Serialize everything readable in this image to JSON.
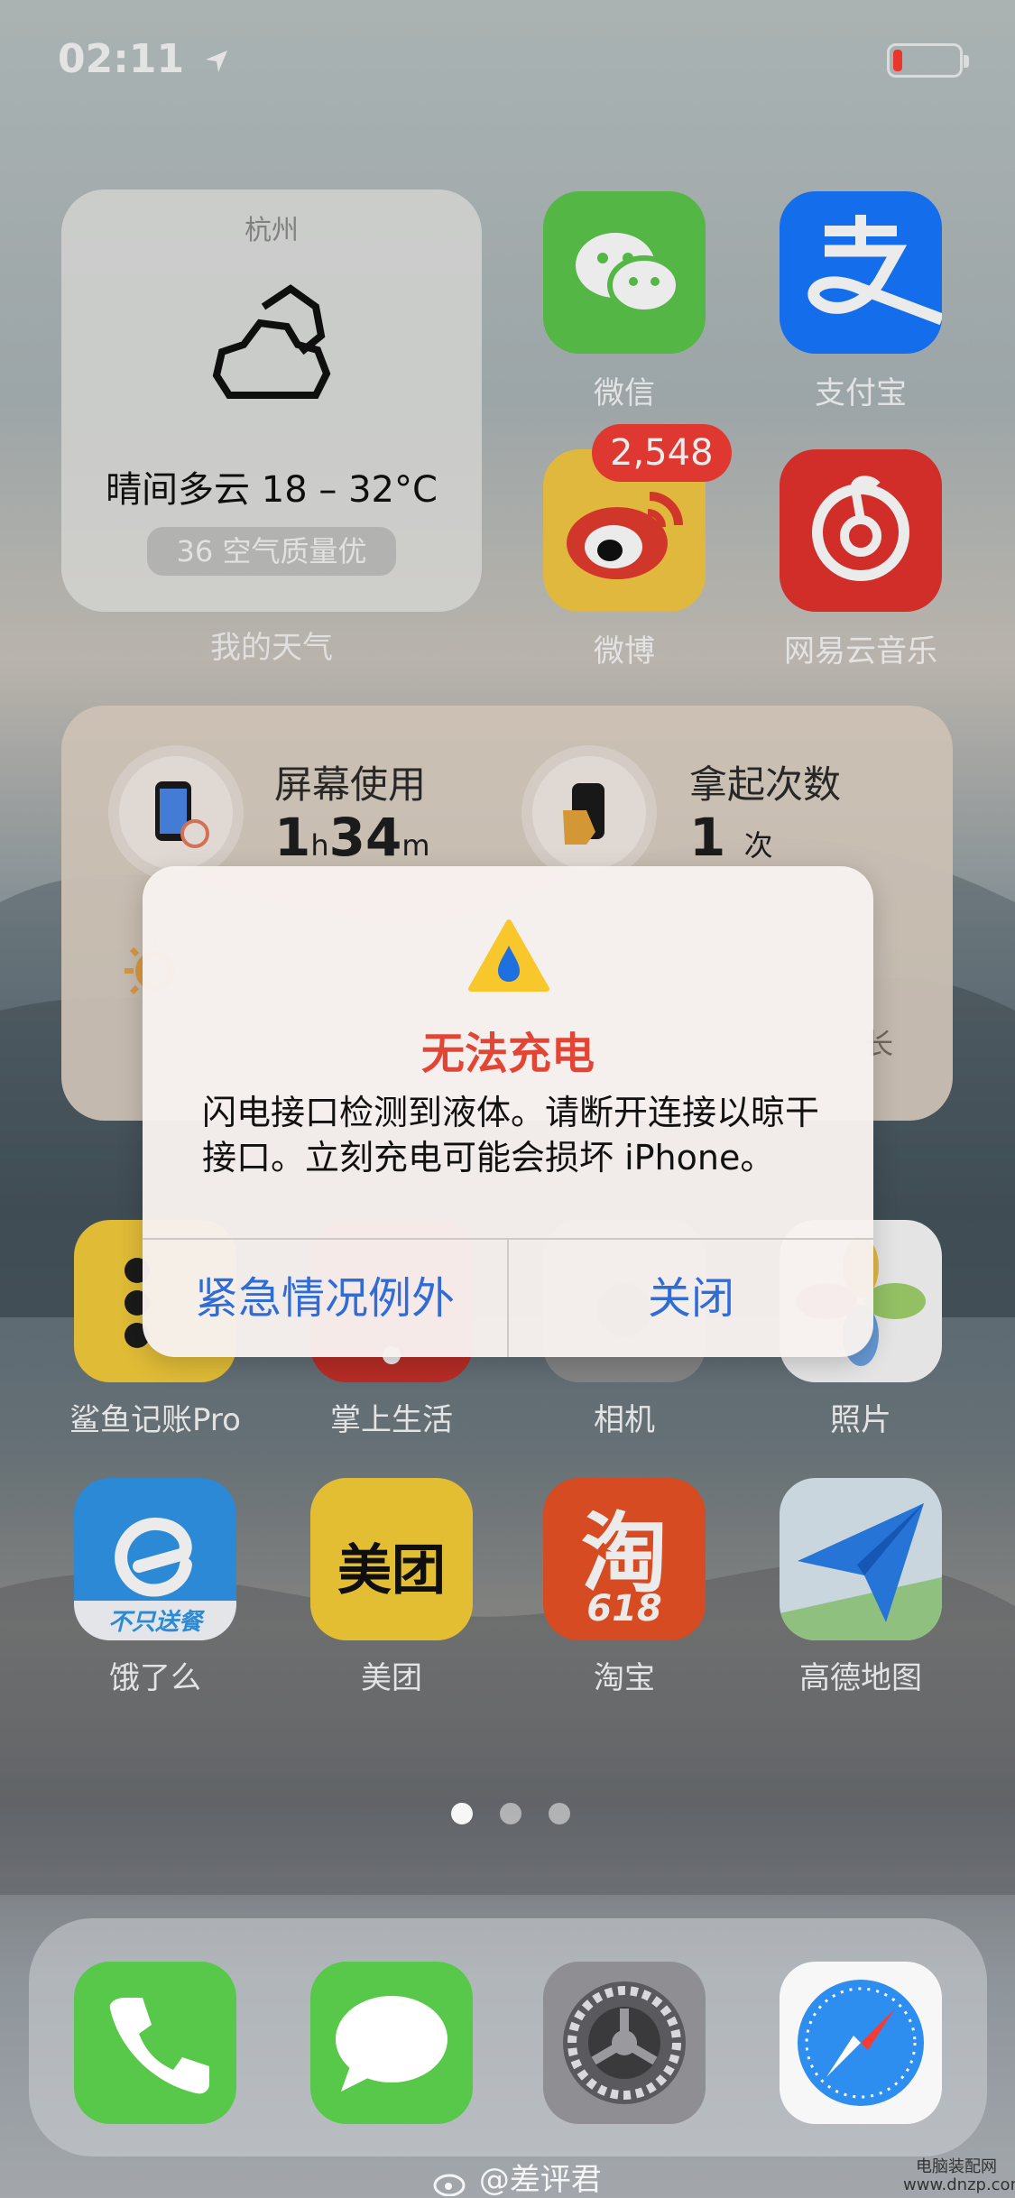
{
  "status": {
    "time": "02:11"
  },
  "weather_widget": {
    "city": "杭州",
    "condition": "晴间多云 18 – 32°C",
    "aqi": "36 空气质量优",
    "label": "我的天气"
  },
  "apps_top": [
    {
      "name": "微信",
      "icon": "wechat-icon"
    },
    {
      "name": "支付宝",
      "icon": "alipay-icon"
    },
    {
      "name": "微博",
      "icon": "weibo-icon",
      "badge": "2,548"
    },
    {
      "name": "网易云音乐",
      "icon": "netease-music-icon"
    }
  ],
  "screen_widget": {
    "screen_time_title": "屏幕使用",
    "screen_time_value_h": "1",
    "screen_time_unit_h": "h",
    "screen_time_value_m": "34",
    "screen_time_unit_m": "m",
    "pickups_title": "拿起次数",
    "pickups_value": "1",
    "pickups_unit": "次",
    "hidden_text": "长"
  },
  "alert": {
    "title": "无法充电",
    "message": "闪电接口检测到液体。请断开连接以晾干接口。立刻充电可能会损坏 iPhone。",
    "button_left": "紧急情况例外",
    "button_right": "关闭"
  },
  "apps_mid": [
    {
      "name": "鲨鱼记账Pro",
      "icon": "shark-ledger-icon"
    },
    {
      "name": "掌上生活",
      "icon": "handheld-life-icon"
    },
    {
      "name": "相机",
      "icon": "camera-icon"
    },
    {
      "name": "照片",
      "icon": "photos-icon"
    }
  ],
  "apps_bottom": [
    {
      "name": "饿了么",
      "icon": "eleme-icon",
      "sub": "不只送餐"
    },
    {
      "name": "美团",
      "icon": "meituan-icon",
      "logo": "美团"
    },
    {
      "name": "淘宝",
      "icon": "taobao-icon",
      "logo": "淘",
      "sub": "618"
    },
    {
      "name": "高德地图",
      "icon": "amap-icon"
    }
  ],
  "dock": [
    {
      "name": "Phone",
      "icon": "phone-icon"
    },
    {
      "name": "Messages",
      "icon": "messages-icon"
    },
    {
      "name": "Settings",
      "icon": "settings-icon"
    },
    {
      "name": "Safari",
      "icon": "safari-icon"
    }
  ],
  "watermark": "@差评君",
  "corner_mark": "电脑装配网\nwww.dnzp.com",
  "page_dots": 3
}
